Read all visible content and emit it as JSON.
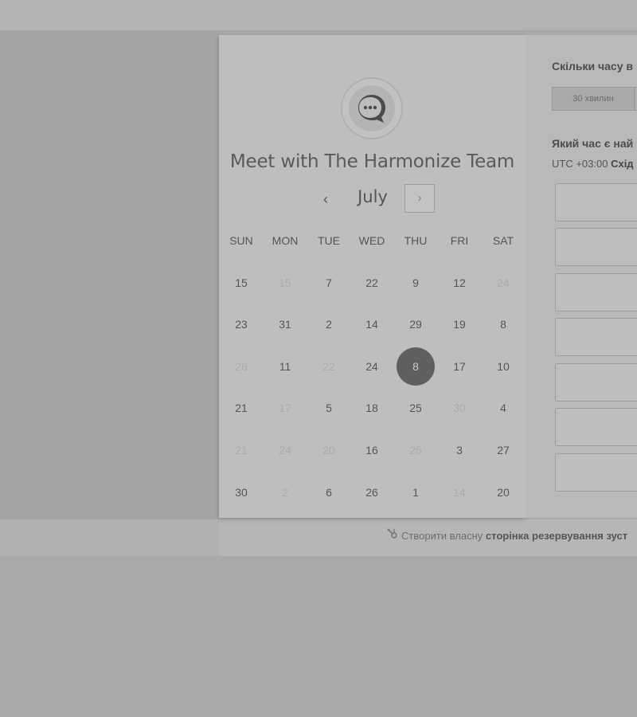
{
  "header": {
    "title": "Meet with The Harmonize Team",
    "month": "July",
    "prev_icon": "‹",
    "next_icon": "›"
  },
  "weekdays": [
    "SUN",
    "MON",
    "TUE",
    "WED",
    "THU",
    "FRI",
    "SAT"
  ],
  "calendar_rows": [
    [
      {
        "d": "15",
        "m": false
      },
      {
        "d": "15",
        "m": true
      },
      {
        "d": "7",
        "m": false
      },
      {
        "d": "22",
        "m": false
      },
      {
        "d": "9",
        "m": false
      },
      {
        "d": "12",
        "m": false
      },
      {
        "d": "24",
        "m": true
      }
    ],
    [
      {
        "d": "23",
        "m": false
      },
      {
        "d": "31",
        "m": false
      },
      {
        "d": "2",
        "m": false
      },
      {
        "d": "14",
        "m": false
      },
      {
        "d": "29",
        "m": false
      },
      {
        "d": "19",
        "m": false
      },
      {
        "d": "8",
        "m": false
      }
    ],
    [
      {
        "d": "26",
        "m": true
      },
      {
        "d": "11",
        "m": false
      },
      {
        "d": "22",
        "m": true
      },
      {
        "d": "24",
        "m": false
      },
      {
        "d": "8",
        "m": false,
        "sel": true
      },
      {
        "d": "17",
        "m": false
      },
      {
        "d": "10",
        "m": false
      }
    ],
    [
      {
        "d": "21",
        "m": false
      },
      {
        "d": "17",
        "m": true
      },
      {
        "d": "5",
        "m": false
      },
      {
        "d": "18",
        "m": false
      },
      {
        "d": "25",
        "m": false
      },
      {
        "d": "30",
        "m": true
      },
      {
        "d": "4",
        "m": false
      }
    ],
    [
      {
        "d": "21",
        "m": true
      },
      {
        "d": "24",
        "m": true
      },
      {
        "d": "20",
        "m": true
      },
      {
        "d": "16",
        "m": false
      },
      {
        "d": "25",
        "m": true
      },
      {
        "d": "3",
        "m": false
      },
      {
        "d": "27",
        "m": false
      }
    ],
    [
      {
        "d": "30",
        "m": false
      },
      {
        "d": "2",
        "m": true
      },
      {
        "d": "6",
        "m": false
      },
      {
        "d": "26",
        "m": false
      },
      {
        "d": "1",
        "m": false
      },
      {
        "d": "14",
        "m": true
      },
      {
        "d": "20",
        "m": false
      }
    ]
  ],
  "side": {
    "duration_question": "Скільки часу в",
    "duration_option": "30 хвилин",
    "time_question": "Який час є най",
    "tz_prefix": "UTC +03:00",
    "tz_name": "Схід"
  },
  "footer": {
    "prefix": "Створити власну",
    "bold": "сторінка резервування зуст"
  },
  "icons": {
    "avatar": "chat-bubble-icon",
    "footer": "sprocket-icon"
  }
}
